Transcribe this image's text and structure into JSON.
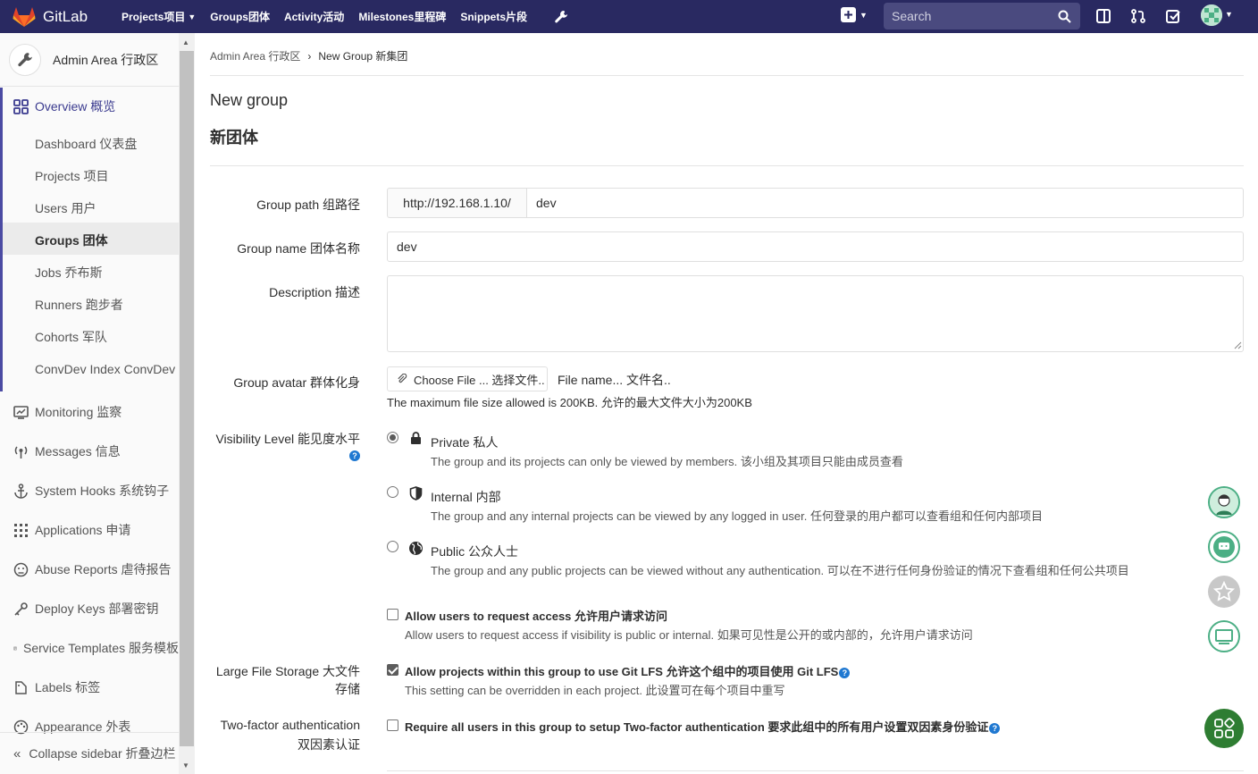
{
  "topbar": {
    "brand": "GitLab",
    "nav": [
      "Projects项目",
      "Groups团体",
      "Activity活动",
      "Milestones里程碑",
      "Snippets片段"
    ],
    "search_placeholder": "Search"
  },
  "sidebar": {
    "title": "Admin Area 行政区",
    "overview": "Overview 概览",
    "sub_items": [
      "Dashboard 仪表盘",
      "Projects 项目",
      "Users 用户",
      "Groups 团体",
      "Jobs 乔布斯",
      "Runners 跑步者",
      "Cohorts 军队",
      "ConvDev Index ConvDev 索引"
    ],
    "main_items": [
      "Monitoring 监察",
      "Messages 信息",
      "System Hooks 系统钩子",
      "Applications 申请",
      "Abuse Reports 虐待报告",
      "Deploy Keys 部署密钥",
      "Service Templates 服务模板",
      "Labels 标签",
      "Appearance 外表"
    ],
    "collapse": "Collapse sidebar 折叠边栏"
  },
  "breadcrumb": {
    "parent": "Admin Area 行政区",
    "current": "New Group 新集团"
  },
  "page": {
    "title": "New group",
    "subtitle": "新团体"
  },
  "form": {
    "group_path_label": "Group path 组路径",
    "group_path_prefix": "http://192.168.1.10/",
    "group_path_value": "dev",
    "group_name_label": "Group name 团体名称",
    "group_name_value": "dev",
    "description_label": "Description 描述",
    "description_value": "",
    "avatar_label": "Group avatar 群体化身",
    "choose_file": "Choose File ... 选择文件..",
    "file_name": "File name... 文件名..",
    "max_size": "The maximum file size allowed is 200KB. 允许的最大文件大小为200KB",
    "visibility_label": "Visibility Level 能见度水平",
    "visibility": [
      {
        "name": "Private 私人",
        "desc": "The group and its projects can only be viewed by members. 该小组及其项目只能由成员查看",
        "selected": true
      },
      {
        "name": "Internal 内部",
        "desc": "The group and any internal projects can be viewed by any logged in user. 任何登录的用户都可以查看组和任何内部项目",
        "selected": false
      },
      {
        "name": "Public 公众人士",
        "desc": "The group and any public projects can be viewed without any authentication. 可以在不进行任何身份验证的情况下查看组和任何公共项目",
        "selected": false
      }
    ],
    "request_access_title": "Allow users to request access 允许用户请求访问",
    "request_access_desc": "Allow users to request access if visibility is public or internal. 如果可见性是公开的或内部的，允许用户请求访问",
    "request_access_checked": false,
    "lfs_label_1": "Large File Storage 大文件",
    "lfs_label_2": "存储",
    "lfs_title": "Allow projects within this group to use Git LFS 允许这个组中的项目使用 Git LFS",
    "lfs_desc": "This setting can be overridden in each project. 此设置可在每个项目中重写",
    "lfs_checked": true,
    "tfa_label_1": "Two-factor authentication",
    "tfa_label_2": "双因素认证",
    "tfa_title": "Require all users in this group to setup Two-factor authentication 要求此组中的所有用户设置双因素身份验证",
    "tfa_checked": false
  }
}
